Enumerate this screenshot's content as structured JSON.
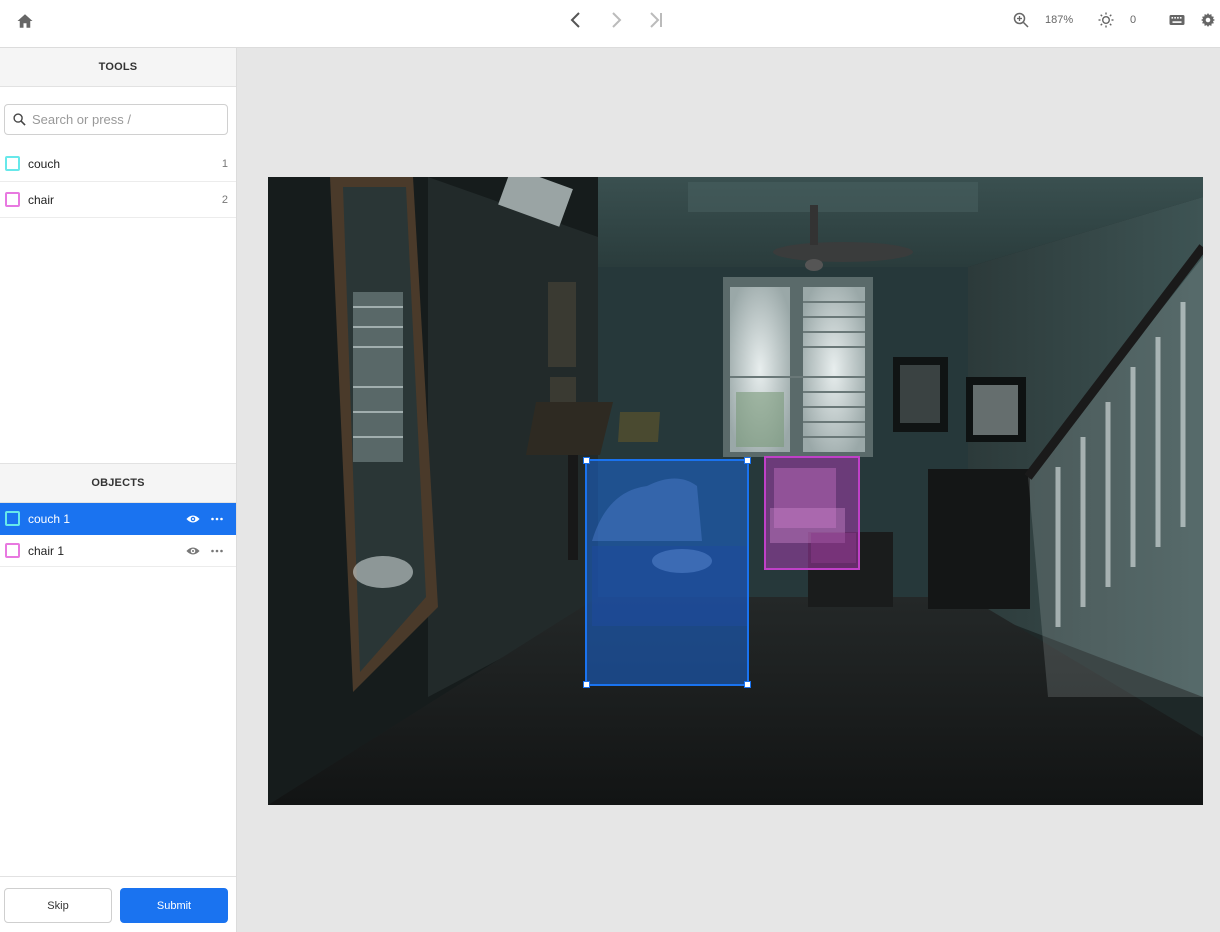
{
  "toolbar": {
    "zoom": "187%",
    "brightness": "0",
    "icons": [
      "home-icon",
      "chevron-left-icon",
      "chevron-right-icon",
      "skip-to-end-icon",
      "zoom-in-icon",
      "sun-icon",
      "keyboard-icon",
      "gear-icon"
    ]
  },
  "tools": {
    "heading": "TOOLS",
    "search_placeholder": "Search or press /",
    "items": [
      {
        "label": "couch",
        "count": "1",
        "color": "#67e8ea"
      },
      {
        "label": "chair",
        "count": "2",
        "color": "#e879e0"
      }
    ]
  },
  "objects": {
    "heading": "OBJECTS",
    "items": [
      {
        "label": "couch 1",
        "color": "#67e8ea",
        "selected": true
      },
      {
        "label": "chair 1",
        "color": "#e879e0",
        "selected": false
      }
    ]
  },
  "actions": {
    "skip": "Skip",
    "submit": "Submit"
  },
  "annotations": {
    "colors": {
      "selected": "#1a73f0",
      "couch": "#1a66d6",
      "chair": "#c040c8"
    }
  }
}
